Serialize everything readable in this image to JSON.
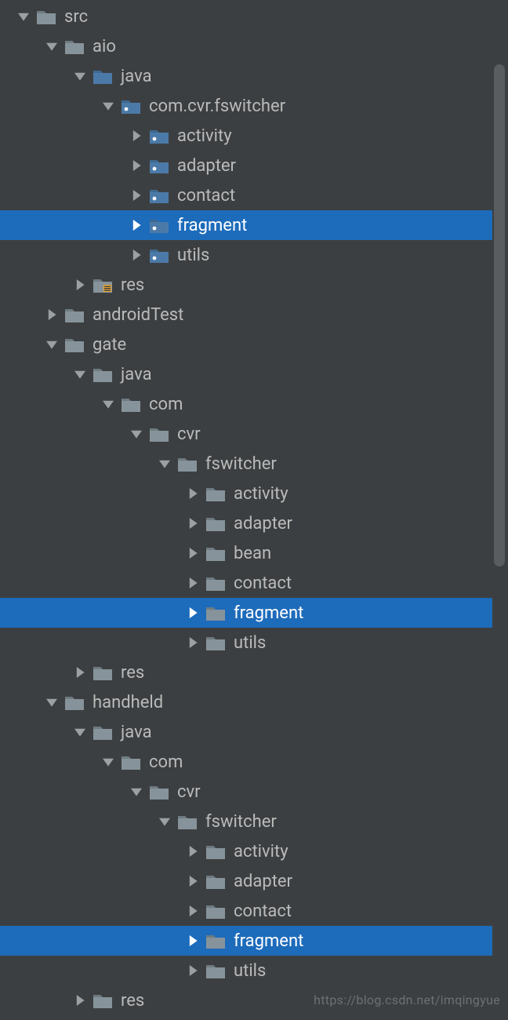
{
  "colors": {
    "bg": "#3c3f41",
    "selection": "#1d6bbb",
    "text": "#bababa",
    "textSel": "#ffffff",
    "folderGrey": "#87939a",
    "folderBlue": "#4c7aa8",
    "pkgGrey": "#87939a",
    "pkgBlue": "#4c7aa8",
    "resStripe": "#f0a732"
  },
  "rows": [
    {
      "indent": 0,
      "arrow": "down",
      "icon": "folder-grey",
      "label": "src",
      "selected": false,
      "name": "tree-item-src"
    },
    {
      "indent": 1,
      "arrow": "down",
      "icon": "folder-grey",
      "label": "aio",
      "selected": false,
      "name": "tree-item-aio"
    },
    {
      "indent": 2,
      "arrow": "down",
      "icon": "folder-blue",
      "label": "java",
      "selected": false,
      "name": "tree-item-aio-java"
    },
    {
      "indent": 3,
      "arrow": "down",
      "icon": "pkg-blue",
      "label": "com.cvr.fswitcher",
      "selected": false,
      "name": "tree-item-aio-pkgroot"
    },
    {
      "indent": 4,
      "arrow": "right",
      "icon": "pkg-blue",
      "label": "activity",
      "selected": false,
      "name": "tree-item-aio-activity"
    },
    {
      "indent": 4,
      "arrow": "right",
      "icon": "pkg-blue",
      "label": "adapter",
      "selected": false,
      "name": "tree-item-aio-adapter"
    },
    {
      "indent": 4,
      "arrow": "right",
      "icon": "pkg-blue",
      "label": "contact",
      "selected": false,
      "name": "tree-item-aio-contact"
    },
    {
      "indent": 4,
      "arrow": "right",
      "icon": "pkg-blue",
      "label": "fragment",
      "selected": true,
      "name": "tree-item-aio-fragment"
    },
    {
      "indent": 4,
      "arrow": "right",
      "icon": "pkg-blue",
      "label": "utils",
      "selected": false,
      "name": "tree-item-aio-utils"
    },
    {
      "indent": 2,
      "arrow": "right",
      "icon": "res",
      "label": "res",
      "selected": false,
      "name": "tree-item-aio-res"
    },
    {
      "indent": 1,
      "arrow": "right",
      "icon": "folder-grey",
      "label": "androidTest",
      "selected": false,
      "name": "tree-item-androidtest"
    },
    {
      "indent": 1,
      "arrow": "down",
      "icon": "folder-grey",
      "label": "gate",
      "selected": false,
      "name": "tree-item-gate"
    },
    {
      "indent": 2,
      "arrow": "down",
      "icon": "folder-grey",
      "label": "java",
      "selected": false,
      "name": "tree-item-gate-java"
    },
    {
      "indent": 3,
      "arrow": "down",
      "icon": "folder-grey",
      "label": "com",
      "selected": false,
      "name": "tree-item-gate-com"
    },
    {
      "indent": 4,
      "arrow": "down",
      "icon": "folder-grey",
      "label": "cvr",
      "selected": false,
      "name": "tree-item-gate-cvr"
    },
    {
      "indent": 5,
      "arrow": "down",
      "icon": "folder-grey",
      "label": "fswitcher",
      "selected": false,
      "name": "tree-item-gate-fswitcher"
    },
    {
      "indent": 6,
      "arrow": "right",
      "icon": "folder-grey",
      "label": "activity",
      "selected": false,
      "name": "tree-item-gate-activity"
    },
    {
      "indent": 6,
      "arrow": "right",
      "icon": "folder-grey",
      "label": "adapter",
      "selected": false,
      "name": "tree-item-gate-adapter"
    },
    {
      "indent": 6,
      "arrow": "right",
      "icon": "folder-grey",
      "label": "bean",
      "selected": false,
      "name": "tree-item-gate-bean"
    },
    {
      "indent": 6,
      "arrow": "right",
      "icon": "folder-grey",
      "label": "contact",
      "selected": false,
      "name": "tree-item-gate-contact"
    },
    {
      "indent": 6,
      "arrow": "right",
      "icon": "folder-grey",
      "label": "fragment",
      "selected": true,
      "name": "tree-item-gate-fragment"
    },
    {
      "indent": 6,
      "arrow": "right",
      "icon": "folder-grey",
      "label": "utils",
      "selected": false,
      "name": "tree-item-gate-utils"
    },
    {
      "indent": 2,
      "arrow": "right",
      "icon": "folder-grey",
      "label": "res",
      "selected": false,
      "name": "tree-item-gate-res"
    },
    {
      "indent": 1,
      "arrow": "down",
      "icon": "folder-grey",
      "label": "handheld",
      "selected": false,
      "name": "tree-item-handheld"
    },
    {
      "indent": 2,
      "arrow": "down",
      "icon": "folder-grey",
      "label": "java",
      "selected": false,
      "name": "tree-item-hh-java"
    },
    {
      "indent": 3,
      "arrow": "down",
      "icon": "folder-grey",
      "label": "com",
      "selected": false,
      "name": "tree-item-hh-com"
    },
    {
      "indent": 4,
      "arrow": "down",
      "icon": "folder-grey",
      "label": "cvr",
      "selected": false,
      "name": "tree-item-hh-cvr"
    },
    {
      "indent": 5,
      "arrow": "down",
      "icon": "folder-grey",
      "label": "fswitcher",
      "selected": false,
      "name": "tree-item-hh-fswitcher"
    },
    {
      "indent": 6,
      "arrow": "right",
      "icon": "folder-grey",
      "label": "activity",
      "selected": false,
      "name": "tree-item-hh-activity"
    },
    {
      "indent": 6,
      "arrow": "right",
      "icon": "folder-grey",
      "label": "adapter",
      "selected": false,
      "name": "tree-item-hh-adapter"
    },
    {
      "indent": 6,
      "arrow": "right",
      "icon": "folder-grey",
      "label": "contact",
      "selected": false,
      "name": "tree-item-hh-contact"
    },
    {
      "indent": 6,
      "arrow": "right",
      "icon": "folder-grey",
      "label": "fragment",
      "selected": true,
      "name": "tree-item-hh-fragment"
    },
    {
      "indent": 6,
      "arrow": "right",
      "icon": "folder-grey",
      "label": "utils",
      "selected": false,
      "name": "tree-item-hh-utils"
    },
    {
      "indent": 2,
      "arrow": "right",
      "icon": "folder-grey",
      "label": "res",
      "selected": false,
      "name": "tree-item-hh-res"
    }
  ],
  "watermark": "https://blog.csdn.net/imqingyue"
}
